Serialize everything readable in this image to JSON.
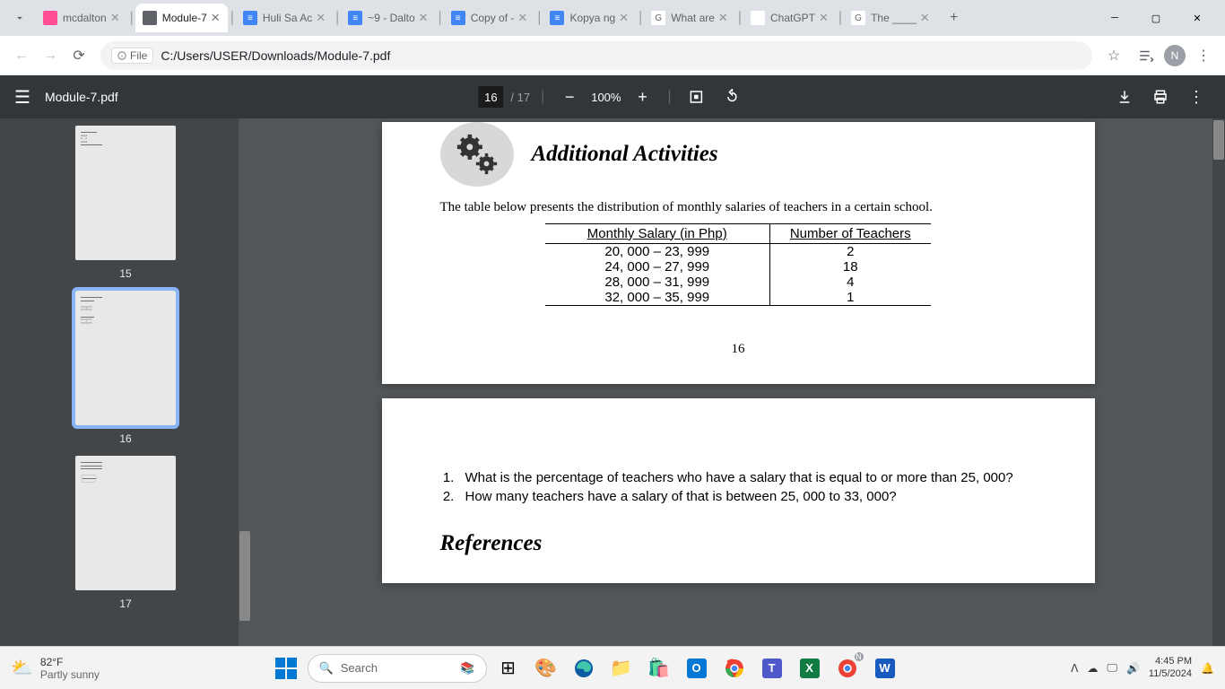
{
  "browser": {
    "tabs": [
      {
        "title": "mcdalton",
        "favicon_bg": "#ff4d94"
      },
      {
        "title": "Module-7",
        "favicon_bg": "#5f6368",
        "active": true
      },
      {
        "title": "Huli Sa Ac",
        "favicon_bg": "#4285f4"
      },
      {
        "title": "~9 - Dalto",
        "favicon_bg": "#4285f4"
      },
      {
        "title": "Copy of -",
        "favicon_bg": "#4285f4"
      },
      {
        "title": "Kopya ng",
        "favicon_bg": "#4285f4"
      },
      {
        "title": "What are",
        "favicon_bg": "#fff"
      },
      {
        "title": "ChatGPT",
        "favicon_bg": "#fff"
      },
      {
        "title": "The ____",
        "favicon_bg": "#fff"
      }
    ],
    "file_chip": "File",
    "url": "C:/Users/USER/Downloads/Module-7.pdf",
    "profile_initial": "N"
  },
  "pdf": {
    "filename": "Module-7.pdf",
    "current_page": "16",
    "total_pages": "17",
    "zoom": "100%",
    "thumbs": [
      "15",
      "16",
      "17"
    ]
  },
  "doc": {
    "activity_title": "Additional Activities",
    "intro": "The table below presents the distribution of monthly salaries of teachers in a certain school.",
    "table": {
      "headers": [
        "Monthly Salary (in Php)",
        "Number of Teachers"
      ],
      "rows": [
        [
          "20, 000 – 23, 999",
          "2"
        ],
        [
          "24, 000 – 27, 999",
          "18"
        ],
        [
          "28, 000 – 31, 999",
          "4"
        ],
        [
          "32, 000 – 35, 999",
          "1"
        ]
      ]
    },
    "page_number": "16",
    "questions": [
      "What is the percentage of teachers who have a salary that is equal to or more than 25, 000?",
      "How many teachers have a salary of that is between 25, 000 to 33, 000?"
    ],
    "references_title": "References"
  },
  "taskbar": {
    "temp": "82°F",
    "condition": "Partly sunny",
    "search_placeholder": "Search",
    "time": "4:45 PM",
    "date": "11/5/2024"
  }
}
